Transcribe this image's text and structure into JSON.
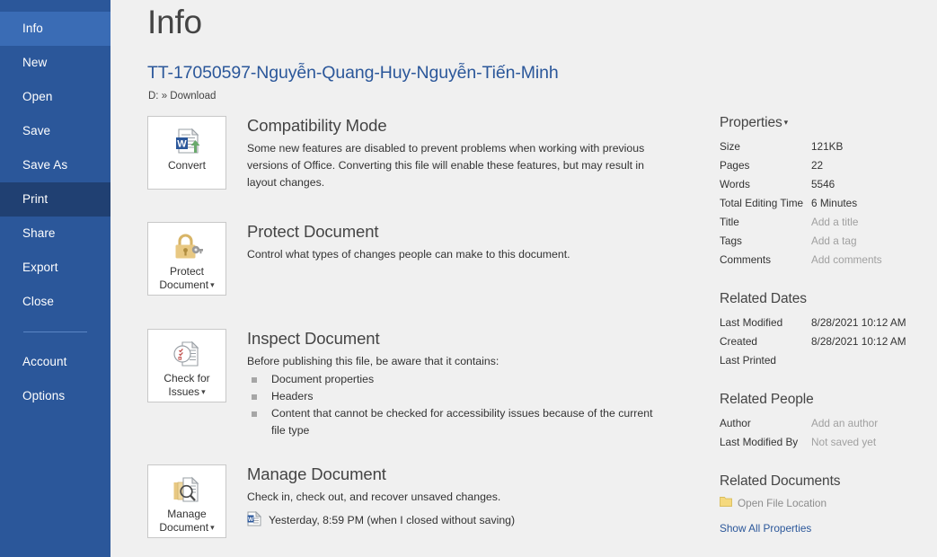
{
  "sidebar": {
    "items": [
      {
        "label": "Info",
        "state": "selected"
      },
      {
        "label": "New",
        "state": "normal"
      },
      {
        "label": "Open",
        "state": "normal"
      },
      {
        "label": "Save",
        "state": "normal"
      },
      {
        "label": "Save As",
        "state": "normal"
      },
      {
        "label": "Print",
        "state": "hover"
      },
      {
        "label": "Share",
        "state": "normal"
      },
      {
        "label": "Export",
        "state": "normal"
      },
      {
        "label": "Close",
        "state": "normal"
      },
      {
        "label": "Account",
        "state": "normal"
      },
      {
        "label": "Options",
        "state": "normal"
      }
    ],
    "colors": {
      "background": "#2b579a",
      "selected": "#3a6cb5",
      "hover": "#204072",
      "divider": "#5b86c4",
      "text": "#ffffff"
    }
  },
  "header": {
    "page_title": "Info",
    "document_title": "TT-17050597-Nguyễn-Quang-Huy-Nguyễn-Tiến-Minh",
    "document_path": "D: » Download"
  },
  "sections": {
    "compatibility": {
      "button_label": "Convert",
      "button_icon": "word-document-convert-icon",
      "heading": "Compatibility Mode",
      "description": "Some new features are disabled to prevent problems when working with previous versions of Office. Converting this file will enable these features, but may result in layout changes."
    },
    "protect": {
      "button_label_line1": "Protect",
      "button_label_line2": "Document",
      "button_icon": "padlock-key-icon",
      "has_caret": true,
      "heading": "Protect Document",
      "description": "Control what types of changes people can make to this document."
    },
    "inspect": {
      "button_label_line1": "Check for",
      "button_label_line2": "Issues",
      "button_icon": "document-inspect-icon",
      "has_caret": true,
      "heading": "Inspect Document",
      "description": "Before publishing this file, be aware that it contains:",
      "bullets": [
        "Document properties",
        "Headers",
        "Content that cannot be checked for accessibility issues because of the current file type"
      ]
    },
    "manage": {
      "button_label_line1": "Manage",
      "button_label_line2": "Document",
      "button_icon": "documents-stack-search-icon",
      "has_caret": true,
      "heading": "Manage Document",
      "description": "Check in, check out, and recover unsaved changes.",
      "recovery_icon": "word-file-icon",
      "recovery_item": "Yesterday, 8:59 PM (when I closed without saving)"
    }
  },
  "properties_panel": {
    "properties": {
      "heading": "Properties",
      "has_caret": true,
      "rows": [
        {
          "label": "Size",
          "value": "121KB",
          "placeholder": false
        },
        {
          "label": "Pages",
          "value": "22",
          "placeholder": false
        },
        {
          "label": "Words",
          "value": "5546",
          "placeholder": false
        },
        {
          "label": "Total Editing Time",
          "value": "6 Minutes",
          "placeholder": false
        },
        {
          "label": "Title",
          "value": "Add a title",
          "placeholder": true
        },
        {
          "label": "Tags",
          "value": "Add a tag",
          "placeholder": true
        },
        {
          "label": "Comments",
          "value": "Add comments",
          "placeholder": true
        }
      ]
    },
    "related_dates": {
      "heading": "Related Dates",
      "rows": [
        {
          "label": "Last Modified",
          "value": "8/28/2021 10:12 AM",
          "placeholder": false
        },
        {
          "label": "Created",
          "value": "8/28/2021 10:12 AM",
          "placeholder": false
        },
        {
          "label": "Last Printed",
          "value": "",
          "placeholder": false
        }
      ]
    },
    "related_people": {
      "heading": "Related People",
      "rows": [
        {
          "label": "Author",
          "value": "Add an author",
          "placeholder": true
        },
        {
          "label": "Last Modified By",
          "value": "Not saved yet",
          "placeholder": true
        }
      ]
    },
    "related_documents": {
      "heading": "Related Documents",
      "open_file_location": "Open File Location",
      "folder_icon": "folder-icon",
      "show_all_properties": "Show All Properties"
    }
  }
}
